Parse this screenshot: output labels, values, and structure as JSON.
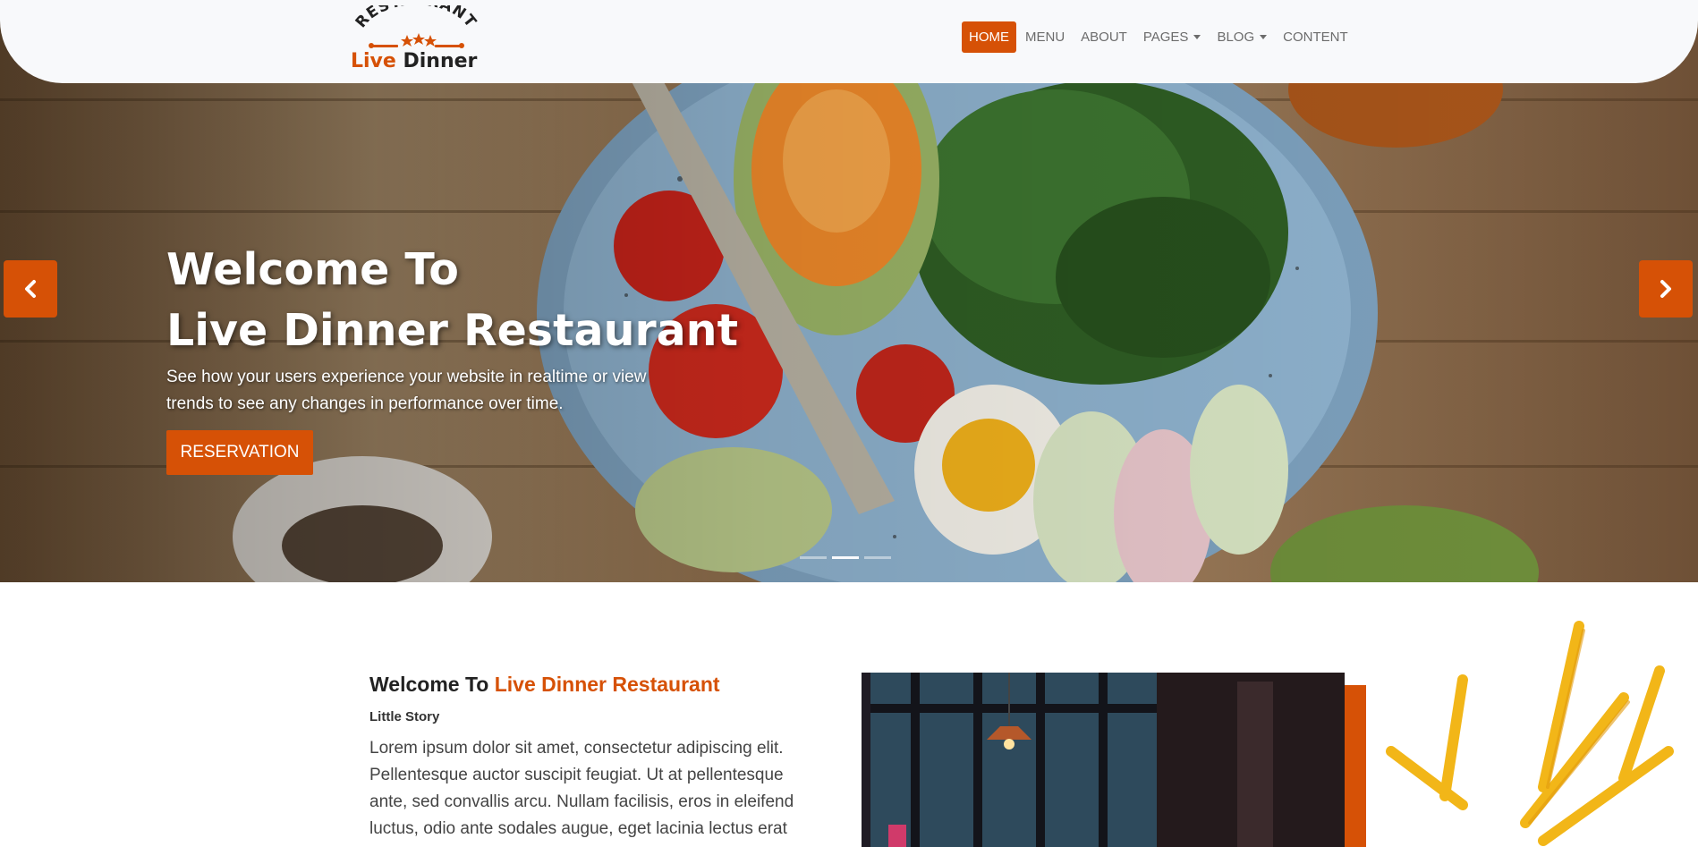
{
  "brand": {
    "arc_text": "RESTAURANT",
    "name_accent": "Live",
    "name_rest": "Dinner",
    "colors": {
      "accent": "#d65106",
      "dark": "#222222"
    }
  },
  "nav": {
    "items": [
      {
        "label": "HOME",
        "active": true
      },
      {
        "label": "MENU"
      },
      {
        "label": "ABOUT"
      },
      {
        "label": "PAGES"
      },
      {
        "label": "BLOG"
      },
      {
        "label": "CONTENT"
      }
    ]
  },
  "hero": {
    "title_line1": "Welcome To",
    "title_line2": "Live Dinner Restaurant",
    "subtitle": "See how your users experience your website in realtime or view trends to see any changes in performance over time.",
    "button_label": "RESERVATION",
    "prev_icon": "chevron-left-icon",
    "next_icon": "chevron-right-icon",
    "slide_count": 3,
    "active_slide": 2
  },
  "about": {
    "title_prefix": "Welcome To",
    "title_accent": "Live Dinner Restaurant",
    "subtitle": "Little Story",
    "text": "Lorem ipsum dolor sit amet, consectetur adipiscing elit. Pellentesque auctor suscipit feugiat. Ut at pellentesque ante, sed convallis arcu. Nullam facilisis, eros in eleifend luctus, odio ante sodales augue, eget lacinia lectus erat"
  }
}
